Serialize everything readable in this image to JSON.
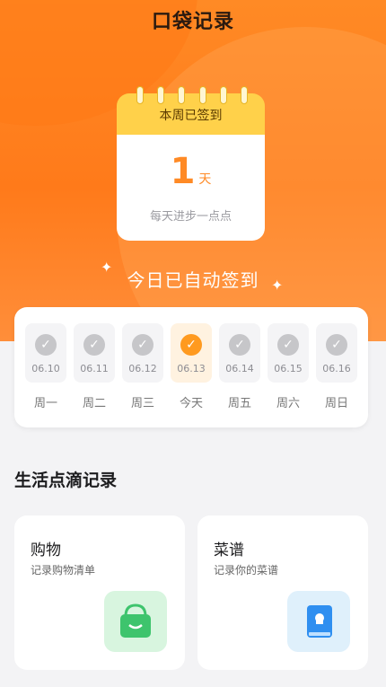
{
  "header": {
    "title": "口袋记录"
  },
  "calendar": {
    "label": "本周已签到",
    "days_number": "1",
    "days_unit": "天",
    "note": "每天进步一点点",
    "accent": "#ff8a25",
    "top_color": "#ffd14a"
  },
  "checkin": {
    "auto_text": "今日已自动签到"
  },
  "week": [
    {
      "date": "06.10",
      "label": "周一",
      "today": false
    },
    {
      "date": "06.11",
      "label": "周二",
      "today": false
    },
    {
      "date": "06.12",
      "label": "周三",
      "today": false
    },
    {
      "date": "06.13",
      "label": "今天",
      "today": true
    },
    {
      "date": "06.14",
      "label": "周五",
      "today": false
    },
    {
      "date": "06.15",
      "label": "周六",
      "today": false
    },
    {
      "date": "06.16",
      "label": "周日",
      "today": false
    }
  ],
  "section": {
    "title": "生活点滴记录"
  },
  "cards": [
    {
      "title": "购物",
      "subtitle": "记录购物清单",
      "icon": "shopping-bag-icon",
      "icon_bg": "#d8f5df"
    },
    {
      "title": "菜谱",
      "subtitle": "记录你的菜谱",
      "icon": "recipe-book-icon",
      "icon_bg": "#dff0fb"
    }
  ]
}
